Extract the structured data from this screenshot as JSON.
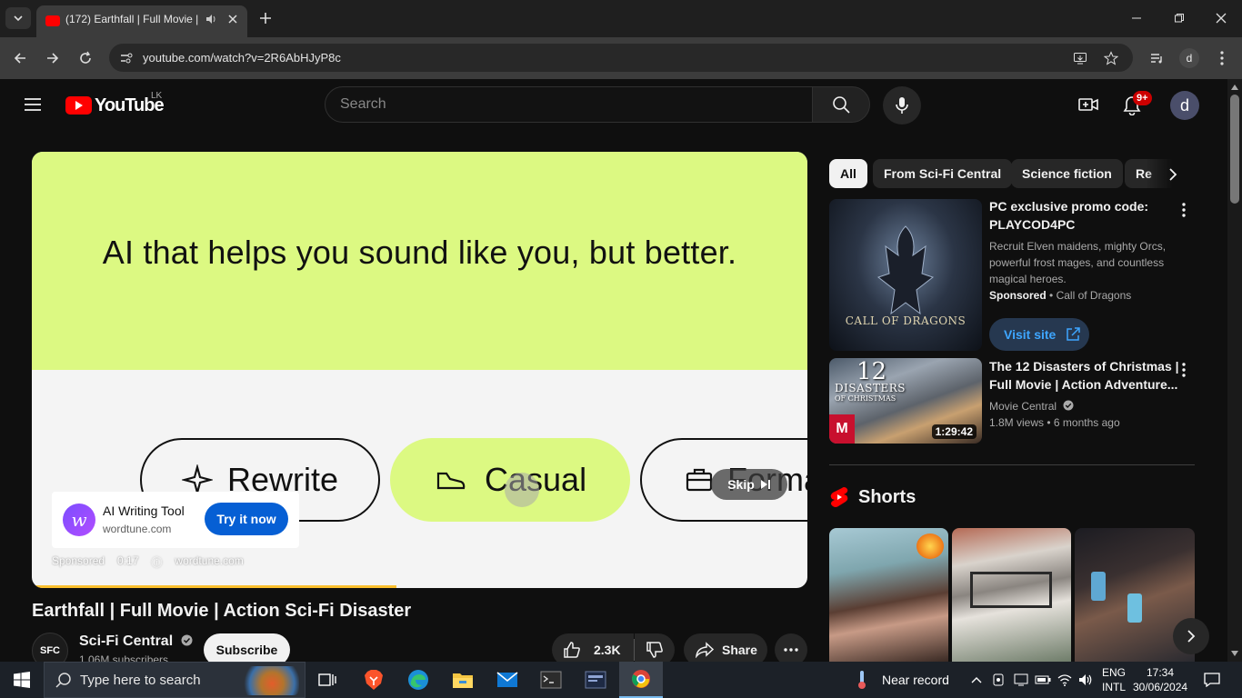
{
  "browser": {
    "tab_title": "(172) Earthfall | Full Movie |",
    "url": "youtube.com/watch?v=2R6AbHJyP8c",
    "profile_initial": "d"
  },
  "youtube": {
    "logo_text": "YouTube",
    "country_code": "LK",
    "search_placeholder": "Search",
    "notifications_badge": "9+",
    "avatar_initial": "d"
  },
  "ad": {
    "headline": "AI that helps you sound like you, but better.",
    "pills": [
      "Rewrite",
      "Casual",
      "Formal"
    ],
    "skip_label": "Skip",
    "advertiser_title": "AI Writing Tool",
    "advertiser_domain": "wordtune.com",
    "cta_label": "Try it now",
    "sponsored_label": "Sponsored",
    "time_label": "0:17",
    "footer_domain": "wordtune.com",
    "progress_fraction": 0.47
  },
  "video": {
    "title": "Earthfall | Full Movie | Action Sci-Fi Disaster",
    "channel_name": "Sci-Fi Central",
    "channel_avatar_text": "SFC",
    "subscribers": "1.06M subscribers",
    "subscribe_label": "Subscribe",
    "likes": "2.3K",
    "share_label": "Share"
  },
  "chips": [
    "All",
    "From Sci-Fi Central",
    "Science fiction",
    "Re"
  ],
  "sidebar": {
    "promo": {
      "title_line1": "PC exclusive promo code:",
      "title_line2": "PLAYCOD4PC",
      "description_line1": "Recruit Elven maidens, mighty Orcs,",
      "description_line2": "powerful frost mages, and countless",
      "description_line3": "magical heroes.",
      "sponsored": "Sponsored",
      "advertiser": "Call of Dragons",
      "visit_label": "Visit site",
      "thumb_text": "CALL OF DRAGONS"
    },
    "video2": {
      "title_line1": "The 12 Disasters of Christmas |",
      "title_line2": "Full Movie | Action Adventure...",
      "channel": "Movie Central",
      "views": "1.8M views",
      "age": "6 months ago",
      "duration": "1:29:42",
      "thumb_text_1": "12",
      "thumb_text_2": "DISASTERS",
      "thumb_text_3": "OF CHRISTMAS"
    },
    "shorts_label": "Shorts"
  },
  "taskbar": {
    "search_placeholder": "Type here to search",
    "weather": "Near record",
    "lang1": "ENG",
    "lang2": "INTL",
    "time": "17:34",
    "date": "30/06/2024"
  },
  "colors": {
    "ad_green": "#dcf982",
    "yt_red": "#ff0000",
    "cta_blue": "#065fd4",
    "progress_yellow": "#fbc02d"
  }
}
